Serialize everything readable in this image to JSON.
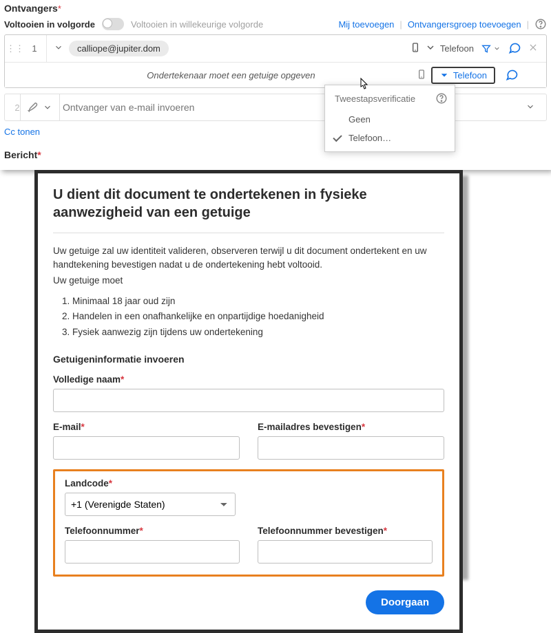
{
  "top": {
    "recipients_label": "Ontvangers",
    "complete_order_label": "Voltooien in volgorde",
    "random_order_label": "Voltooien in willekeurige volgorde",
    "add_me": "Mij toevoegen",
    "add_group": "Ontvangersgroep toevoegen"
  },
  "row1": {
    "order": "1",
    "email": "calliope@jupiter.dom",
    "phone": "Telefoon"
  },
  "witness": {
    "label": "Ondertekenaar moet een getuige opgeven",
    "phone": "Telefoon"
  },
  "tsv": {
    "title": "Tweestapsverificatie",
    "none": "Geen",
    "phone": "Telefoon…"
  },
  "row2": {
    "order": "2",
    "placeholder": "Ontvanger van e-mail invoeren"
  },
  "cc": "Cc tonen",
  "bericht": "Bericht",
  "modal": {
    "title": "U dient dit document te ondertekenen in fysieke aanwezigheid van een getuige",
    "p1": "Uw getuige zal uw identiteit valideren, observeren terwijl u dit document ondertekent en uw handtekening bevestigen nadat u de ondertekening hebt voltooid.",
    "p2": "Uw getuige moet",
    "li1": "Minimaal 18 jaar oud zijn",
    "li2": "Handelen in een onafhankelijke en onpartijdige hoedanigheid",
    "li3": "Fysiek aanwezig zijn tijdens uw ondertekening",
    "sec": "Getuigeninformatie invoeren",
    "fullname": "Volledige naam",
    "email": "E-mail",
    "email_confirm": "E-mailadres bevestigen",
    "country": "Landcode",
    "country_val": "+1 (Verenigde Staten)",
    "phone": "Telefoonnummer",
    "phone_confirm": "Telefoonnummer bevestigen",
    "continue": "Doorgaan"
  }
}
